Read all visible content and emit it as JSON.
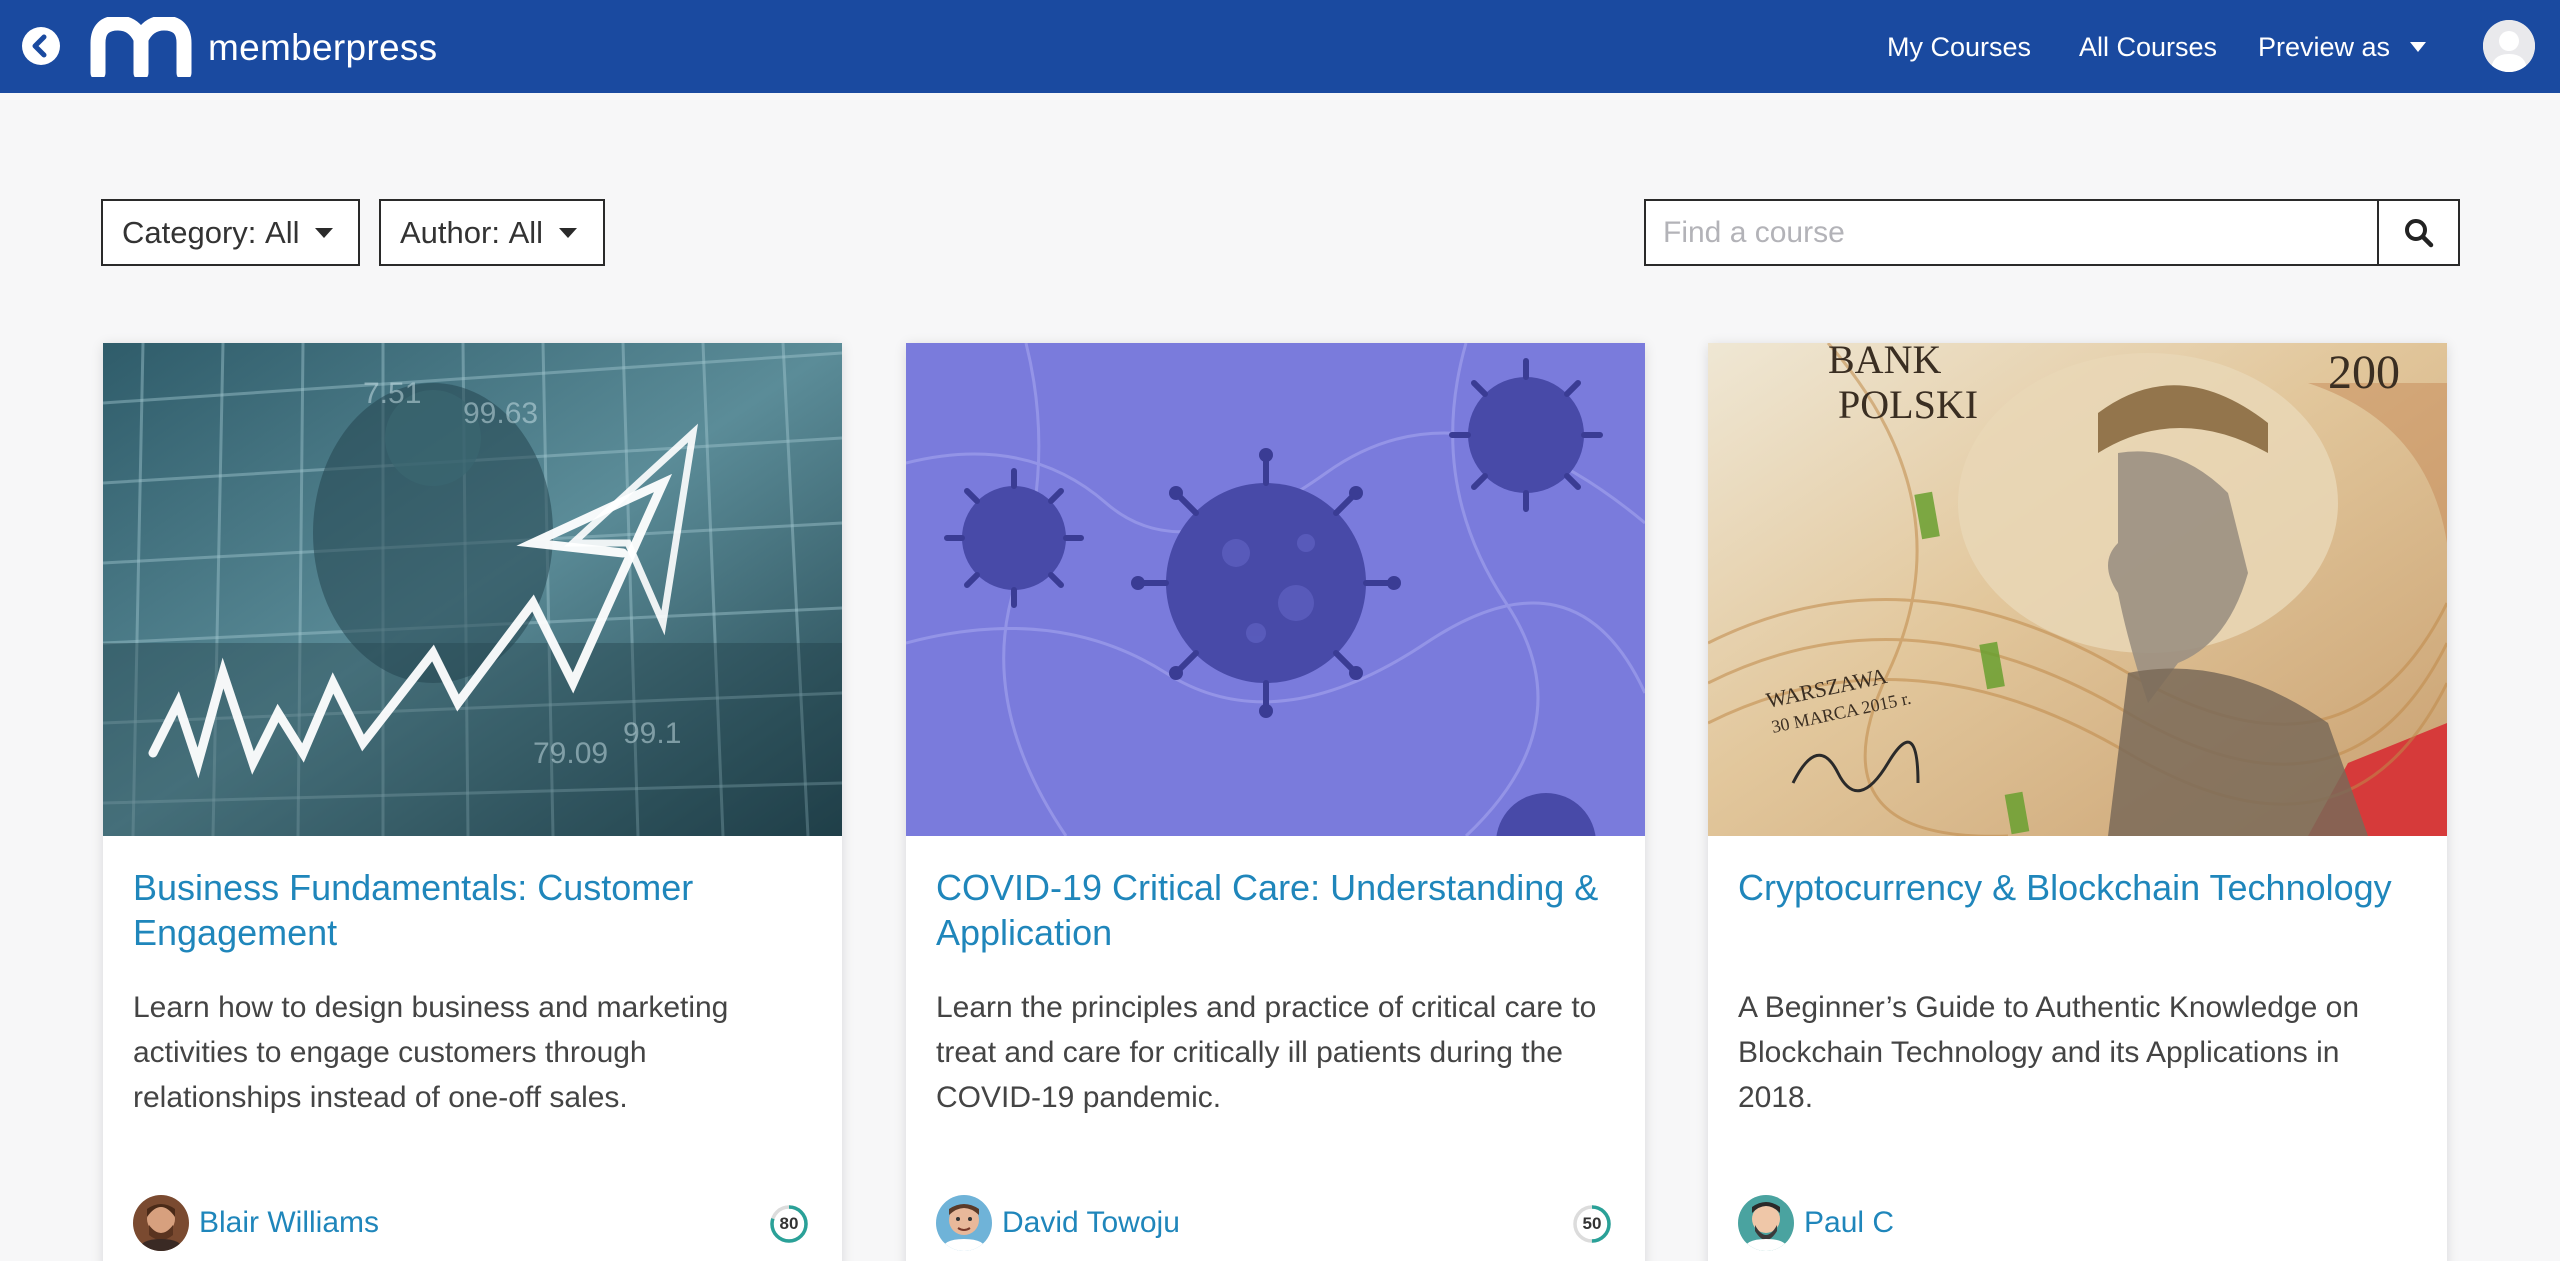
{
  "header": {
    "logo_text": "memberpress",
    "nav": {
      "my_courses": "My Courses",
      "all_courses": "All Courses",
      "preview_as": "Preview as"
    }
  },
  "filters": {
    "category_label": "Category:",
    "category_value": "All",
    "author_label": "Author:",
    "author_value": "All",
    "search_placeholder": "Find a course"
  },
  "courses": [
    {
      "title": "Business Fundamentals: Customer Engagement",
      "description": "Learn how to design business and marketing activities to engage customers through relationships instead of one-off sales.",
      "author": "Blair Williams",
      "progress": 80
    },
    {
      "title": "COVID-19 Critical Care: Understanding & Application",
      "description": "Learn the principles and practice of critical care to treat and care for critically ill patients during the COVID-19 pandemic.",
      "author": "David Towoju",
      "progress": 50
    },
    {
      "title": "Cryptocurrency & Blockchain Technology",
      "description": "A Beginner’s Guide to Authentic Knowledge on Blockchain Technology and its Applications in 2018.",
      "author": "Paul C",
      "progress": null
    }
  ],
  "colors": {
    "header_bg": "#1a4aa0",
    "link": "#1f86bb",
    "progress_ring": "#2aa198"
  },
  "icons": {
    "back": "back-arrow-circle-icon",
    "search": "search-icon",
    "user": "user-avatar-icon"
  }
}
